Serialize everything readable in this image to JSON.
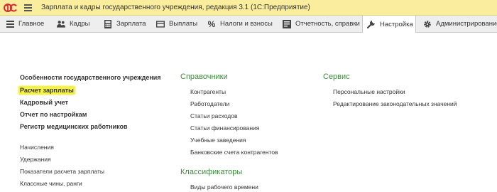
{
  "window": {
    "title": "Зарплата и кадры государственного учреждения, редакция 3.1  (1С:Предприятие)"
  },
  "sections": [
    {
      "label": "Главное",
      "icon": "main-menu-icon"
    },
    {
      "label": "Кадры",
      "icon": "people-icon"
    },
    {
      "label": "Зарплата",
      "icon": "calculator-icon"
    },
    {
      "label": "Выплаты",
      "icon": "payments-icon"
    },
    {
      "label": "Налоги и взносы",
      "icon": "percent-icon"
    },
    {
      "label": "Отчетность, справки",
      "icon": "reports-icon"
    },
    {
      "label": "Настройка",
      "icon": "wrench-icon",
      "active": true
    },
    {
      "label": "Администрирование",
      "icon": "gear-icon"
    }
  ],
  "left": {
    "bold_links": [
      "Особенности государственного учреждения",
      "Расчет зарплаты",
      "Кадровый учет",
      "Отчет по настройкам",
      "Регистр медицинских работников"
    ],
    "links": [
      "Начисления",
      "Удержания",
      "Показатели расчета зарплаты",
      "Классные чины, ранги"
    ]
  },
  "middle": {
    "directories_heading": "Справочники",
    "directories": [
      "Контрагенты",
      "Работодатели",
      "Статьи расходов",
      "Статьи финансирования",
      "Учебные заведения",
      "Банковские счета контрагентов"
    ],
    "classifiers_heading": "Классификаторы",
    "classifiers": [
      "Виды рабочего времени"
    ]
  },
  "right": {
    "service_heading": "Сервис",
    "service": [
      "Персональные настройки",
      "Редактирование законодательных значений"
    ]
  },
  "colors": {
    "titlebar": "#fbed9e",
    "heading_green": "#3d8a3d",
    "highlight": "#f6f241"
  }
}
